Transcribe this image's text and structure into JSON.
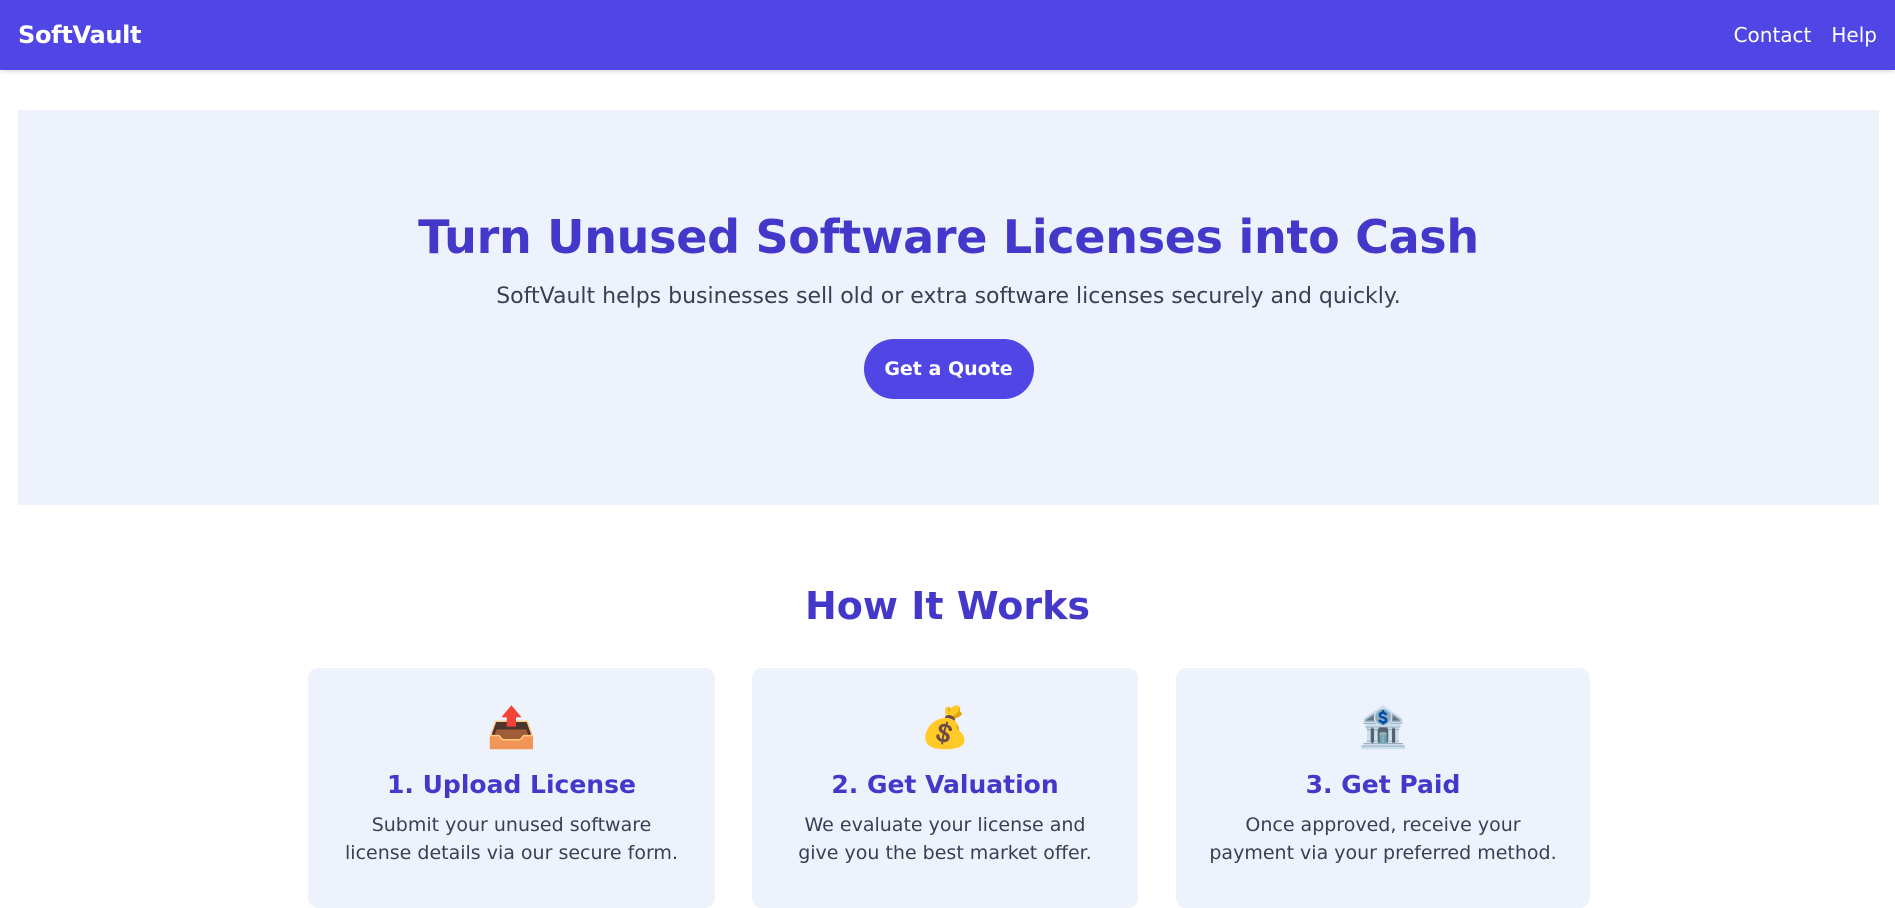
{
  "navbar": {
    "brand": "SoftVault",
    "links": [
      "Contact",
      "Help"
    ]
  },
  "hero": {
    "title": "Turn Unused Software Licenses into Cash",
    "subtitle": "SoftVault helps businesses sell old or extra software licenses securely and quickly.",
    "cta_label": "Get a Quote"
  },
  "how_it_works": {
    "title": "How It Works",
    "steps": [
      {
        "icon": "📤",
        "icon_name": "upload-tray-icon",
        "title": "1. Upload License",
        "description": "Submit your unused software license details via our secure form."
      },
      {
        "icon": "💰",
        "icon_name": "money-bag-icon",
        "title": "2. Get Valuation",
        "description": "We evaluate your license and give you the best market offer."
      },
      {
        "icon": "🏦",
        "icon_name": "bank-icon",
        "title": "3. Get Paid",
        "description": "Once approved, receive your payment via your preferred method."
      }
    ]
  },
  "colors": {
    "primary": "#4f46e5",
    "heading": "#4338ca",
    "panel_bg": "#eef2fd",
    "body_text": "#374151"
  }
}
